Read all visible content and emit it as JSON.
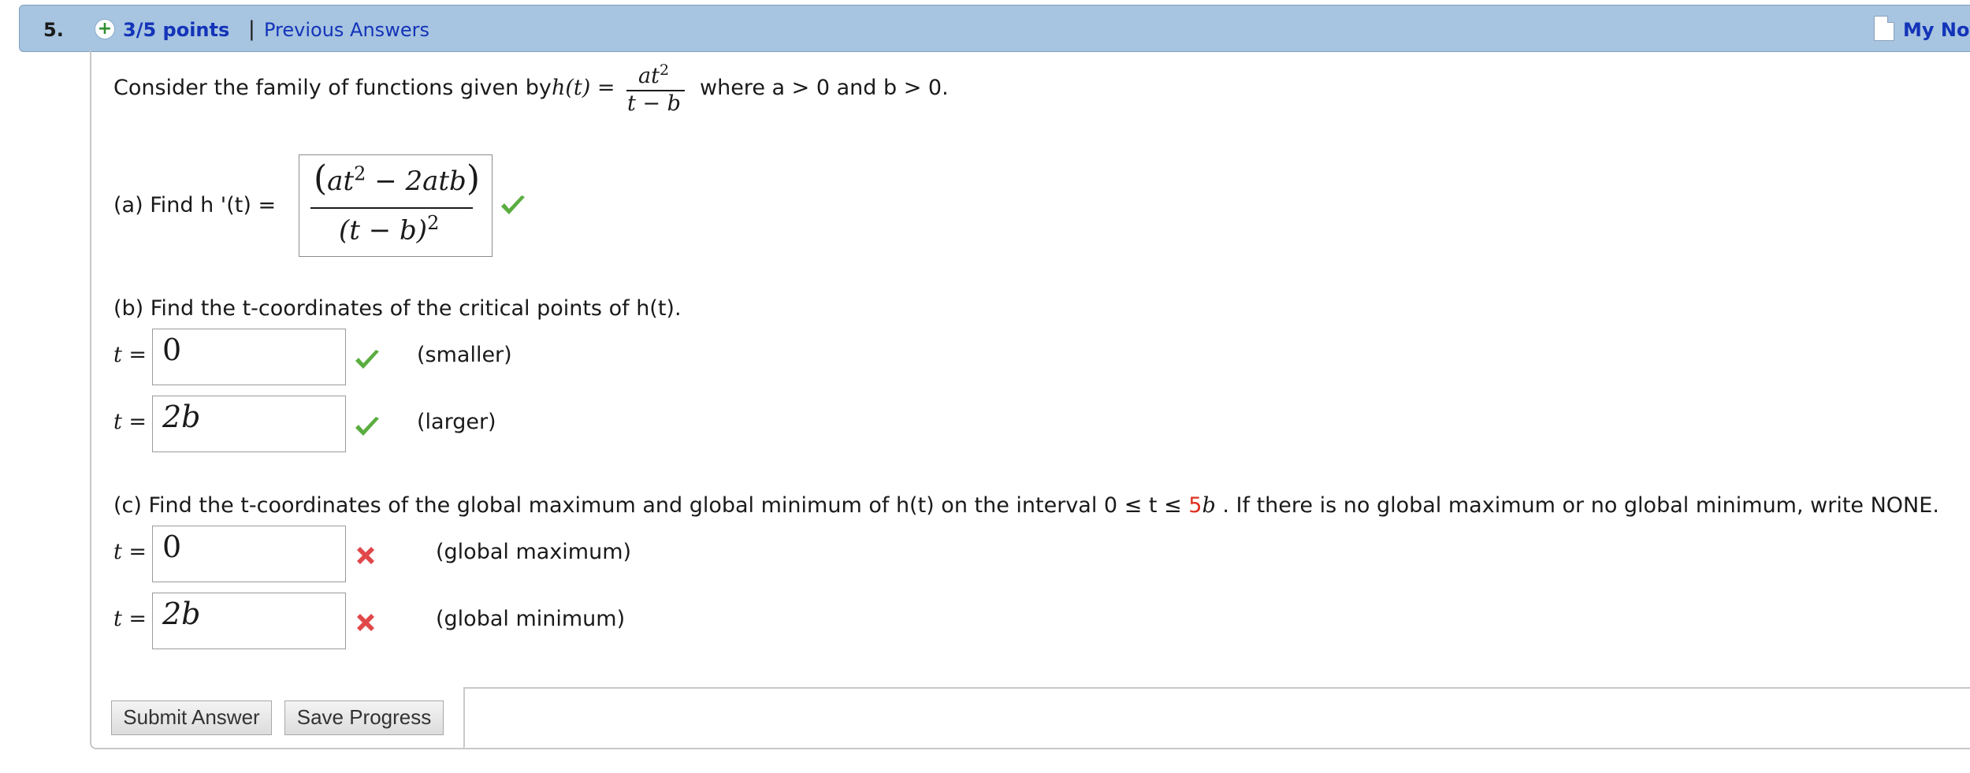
{
  "header": {
    "question_number": "5.",
    "points": "3/5 points",
    "separator": "|",
    "previous_answers": "Previous Answers",
    "my_notes": "My Notes"
  },
  "problem": {
    "intro_prefix": "Consider the family of functions given by",
    "function_lhs": "h(t) =",
    "fraction_numerator": "at",
    "fraction_numerator_exp": "2",
    "fraction_denominator": "t − b",
    "intro_suffix": "where a > 0 and b > 0."
  },
  "part_a": {
    "prompt": "(a) Find  h '(t)  =",
    "answer_numerator_open": "(",
    "answer_numerator_base": "at",
    "answer_numerator_exp": "2",
    "answer_numerator_rest": " − 2atb",
    "answer_numerator_close": ")",
    "answer_denominator": "(t − b)",
    "answer_denominator_exp": "2",
    "status": "correct"
  },
  "part_b": {
    "prompt": "(b) Find the t-coordinates of the critical points of h(t).",
    "rows": [
      {
        "label": "t =",
        "value": "0",
        "status": "correct",
        "note": "(smaller)"
      },
      {
        "label": "t =",
        "value": "2b",
        "status": "correct",
        "note": "(larger)"
      }
    ]
  },
  "part_c": {
    "prompt_prefix": "(c) Find the t-coordinates of the global maximum and global minimum of h(t) on the interval  0 ≤ t ≤",
    "interval_coefficient": "5",
    "interval_var": "b",
    "prompt_suffix": ". If there is no global maximum or no global minimum, write NONE.",
    "rows": [
      {
        "label": "t =",
        "value": "0",
        "status": "incorrect",
        "note": "(global maximum)"
      },
      {
        "label": "t =",
        "value": "2b",
        "status": "incorrect",
        "note": "(global minimum)"
      }
    ]
  },
  "buttons": {
    "submit": "Submit Answer",
    "save": "Save Progress"
  },
  "colors": {
    "header_bg": "#a7c4e1",
    "link": "#1334b8",
    "correct": "#5aad3f",
    "incorrect": "#e0484a",
    "highlight": "#e0301e"
  }
}
